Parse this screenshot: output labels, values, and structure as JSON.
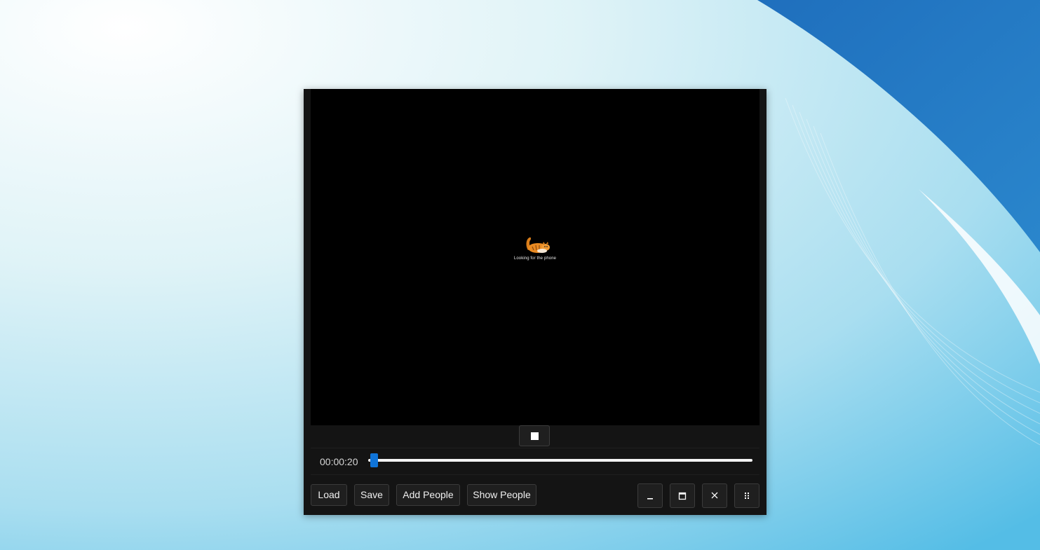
{
  "video": {
    "caption": "Looking for the phone"
  },
  "playback": {
    "stop_icon": "stop-icon",
    "time": "00:00:20",
    "position_fraction": 0.01
  },
  "toolbar": {
    "load_label": "Load",
    "save_label": "Save",
    "add_people_label": "Add People",
    "show_people_label": "Show People"
  },
  "window_controls": {
    "minimize_icon": "minimize-icon",
    "maximize_icon": "maximize-icon",
    "close_icon": "close-icon",
    "grip_icon": "grip-dots-icon"
  },
  "colors": {
    "accent": "#0f74d9",
    "panel": "#141414",
    "button": "#1f1f1f",
    "video": "#000000"
  }
}
